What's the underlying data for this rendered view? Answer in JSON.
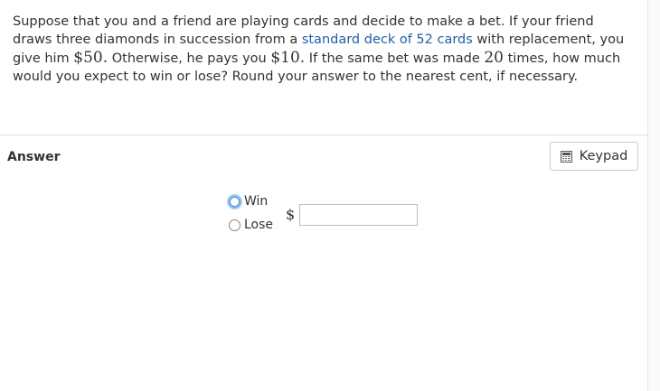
{
  "question": {
    "part1": "Suppose that you and a friend are playing cards and decide to make a bet. If your friend draws three diamonds in succession from a ",
    "link_text": "standard deck of 52 cards",
    "part2": " with replacement, you give him ",
    "amount_win": "$50.",
    "part3": " Otherwise, he pays you ",
    "amount_lose": "$10.",
    "part4": " If the same bet was made ",
    "times": "20",
    "part5": " times, how much would you expect to win or lose? Round your answer to the nearest cent, if necessary."
  },
  "answer": {
    "label": "Answer",
    "keypad_label": "Keypad",
    "options": [
      "Win",
      "Lose"
    ],
    "currency_symbol": "$",
    "input_value": ""
  }
}
